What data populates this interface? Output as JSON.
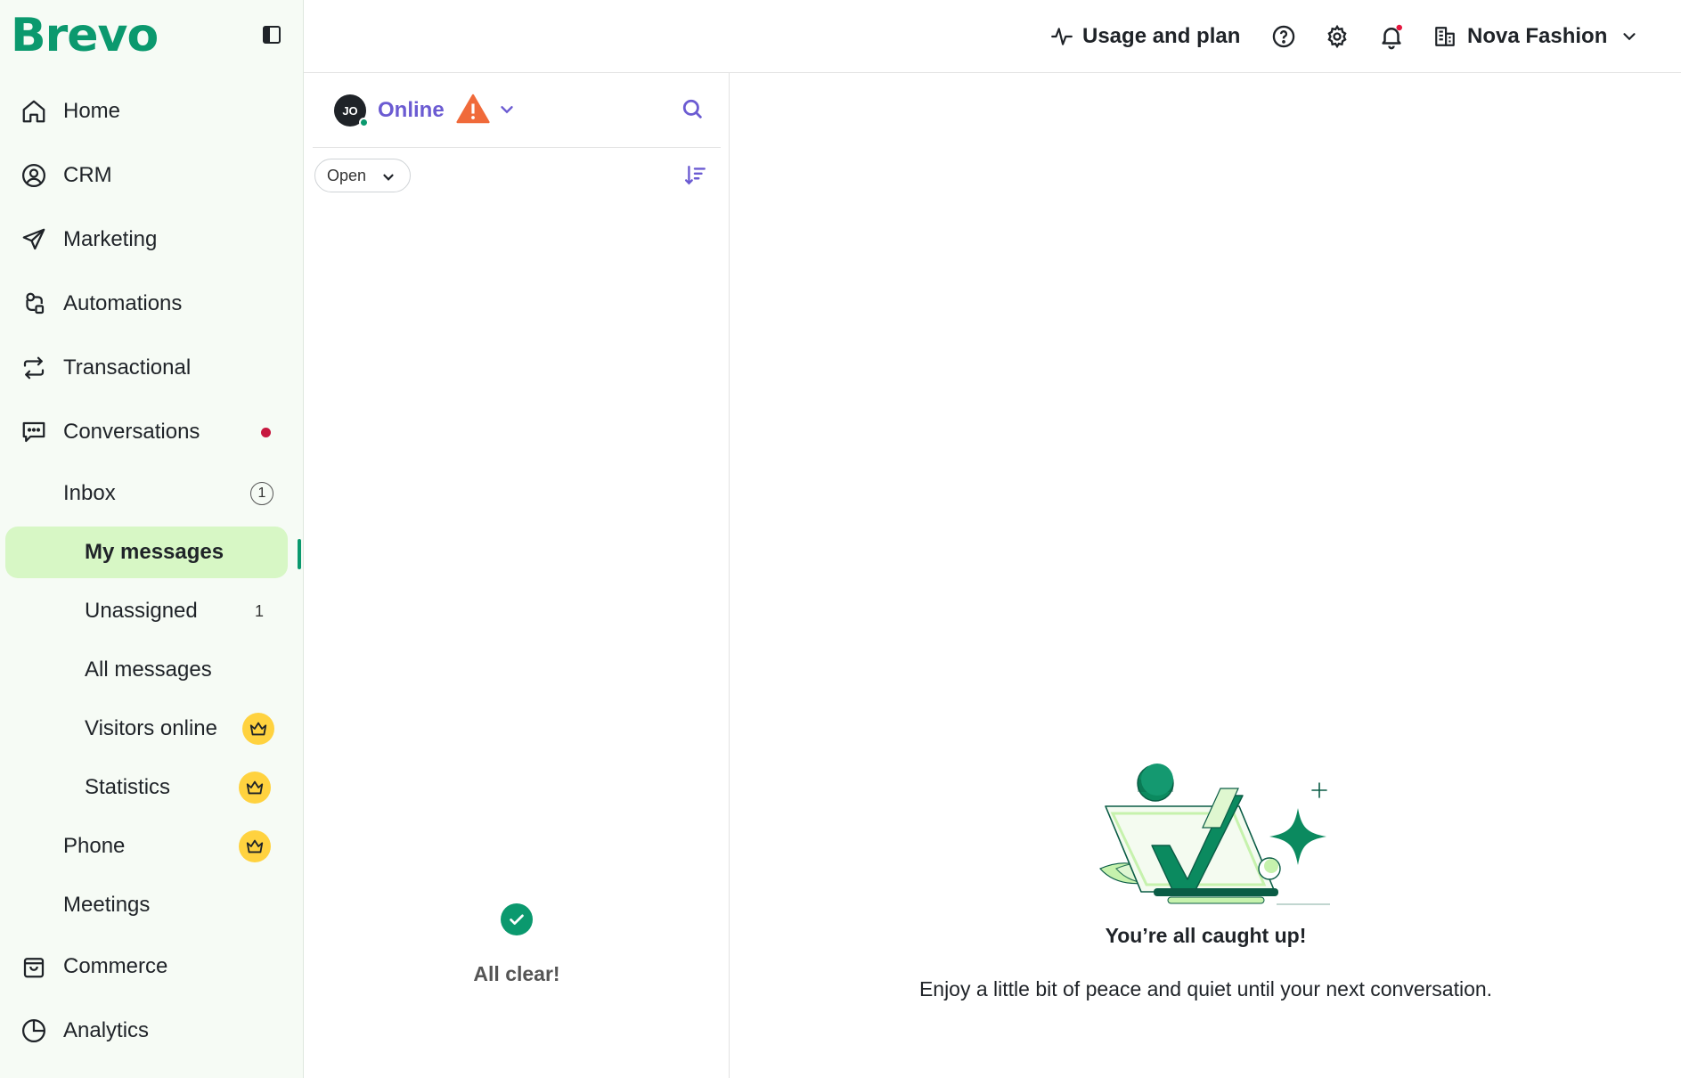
{
  "brand": {
    "logo": "Brevo",
    "color": "#0b996e"
  },
  "sidebar": {
    "nav": [
      {
        "label": "Home",
        "icon": "home-icon"
      },
      {
        "label": "CRM",
        "icon": "user-circle-icon"
      },
      {
        "label": "Marketing",
        "icon": "paper-plane-icon"
      },
      {
        "label": "Automations",
        "icon": "automation-icon"
      },
      {
        "label": "Transactional",
        "icon": "arrows-swap-icon"
      },
      {
        "label": "Conversations",
        "icon": "chat-icon",
        "has_notification": true
      }
    ],
    "conversations_sub": {
      "inbox": {
        "label": "Inbox",
        "count": "1"
      },
      "my_messages": {
        "label": "My messages",
        "active": true
      },
      "unassigned": {
        "label": "Unassigned",
        "count": "1"
      },
      "all_messages": {
        "label": "All messages"
      },
      "visitors_online": {
        "label": "Visitors online",
        "premium": true
      },
      "statistics": {
        "label": "Statistics",
        "premium": true
      },
      "phone": {
        "label": "Phone",
        "premium": true
      },
      "meetings": {
        "label": "Meetings"
      }
    },
    "nav_bottom": [
      {
        "label": "Commerce",
        "icon": "shopping-bag-icon"
      },
      {
        "label": "Analytics",
        "icon": "pie-chart-icon"
      }
    ]
  },
  "topbar": {
    "usage_label": "Usage and plan",
    "account_name": "Nova Fashion"
  },
  "list_panel": {
    "avatar_initials": "JO",
    "status": "Online",
    "filter": "Open",
    "empty_title": "All clear!"
  },
  "main": {
    "empty_title": "You’re all caught up!",
    "empty_subtitle": "Enjoy a little bit of peace and quiet until your next conversation."
  },
  "colors": {
    "accent_purple": "#6b5bd2",
    "active_bg": "#d7f7c5",
    "notification_red": "#c7183f",
    "warning_orange": "#f06a3a",
    "premium_yellow": "#ffd23f"
  }
}
